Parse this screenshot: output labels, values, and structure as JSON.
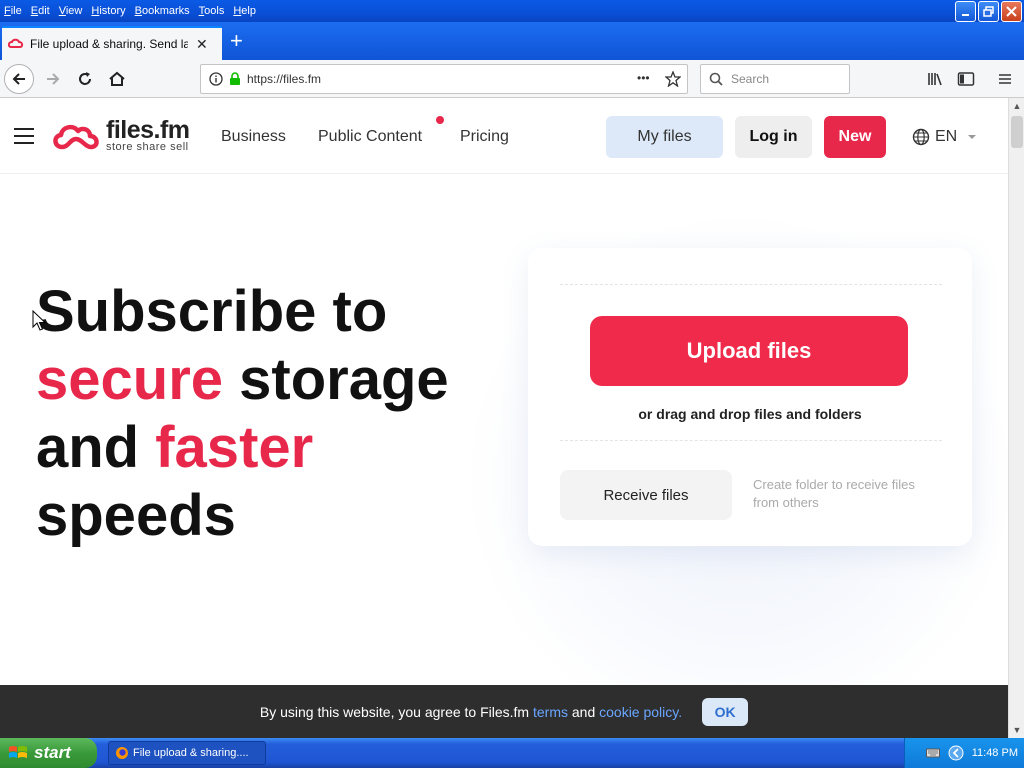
{
  "menubar": {
    "items": [
      "File",
      "Edit",
      "View",
      "History",
      "Bookmarks",
      "Tools",
      "Help"
    ]
  },
  "tab": {
    "title": "File upload & sharing. Send large p",
    "close": "✕"
  },
  "newtab": "+",
  "urlbar": {
    "url": "https://files.fm",
    "more": "•••"
  },
  "search": {
    "placeholder": "Search"
  },
  "site": {
    "logo_name": "files.fm",
    "logo_tagline": "store  share  sell",
    "nav": {
      "business": "Business",
      "public_content": "Public Content",
      "pricing": "Pricing"
    },
    "buttons": {
      "my_files": "My files",
      "log_in": "Log in",
      "new": "New"
    },
    "lang": "EN",
    "accent_color": "#e8284a"
  },
  "hero": {
    "line1": "Subscribe to",
    "line2_accent": "secure",
    "line2_rest": " storage",
    "line3_start": "and ",
    "line3_accent": "faster",
    "line4": "speeds"
  },
  "upload_card": {
    "upload_label": "Upload files",
    "drag_text": "or drag and drop files and folders",
    "receive_label": "Receive files",
    "receive_desc": "Create folder to receive files from others"
  },
  "cookie": {
    "text_before": "By using this website, you agree to Files.fm ",
    "terms": "terms",
    "and": " and ",
    "policy": "cookie policy.",
    "ok": "OK"
  },
  "taskbar": {
    "start": "start",
    "task": "File upload & sharing....",
    "clock": "11:48 PM"
  }
}
